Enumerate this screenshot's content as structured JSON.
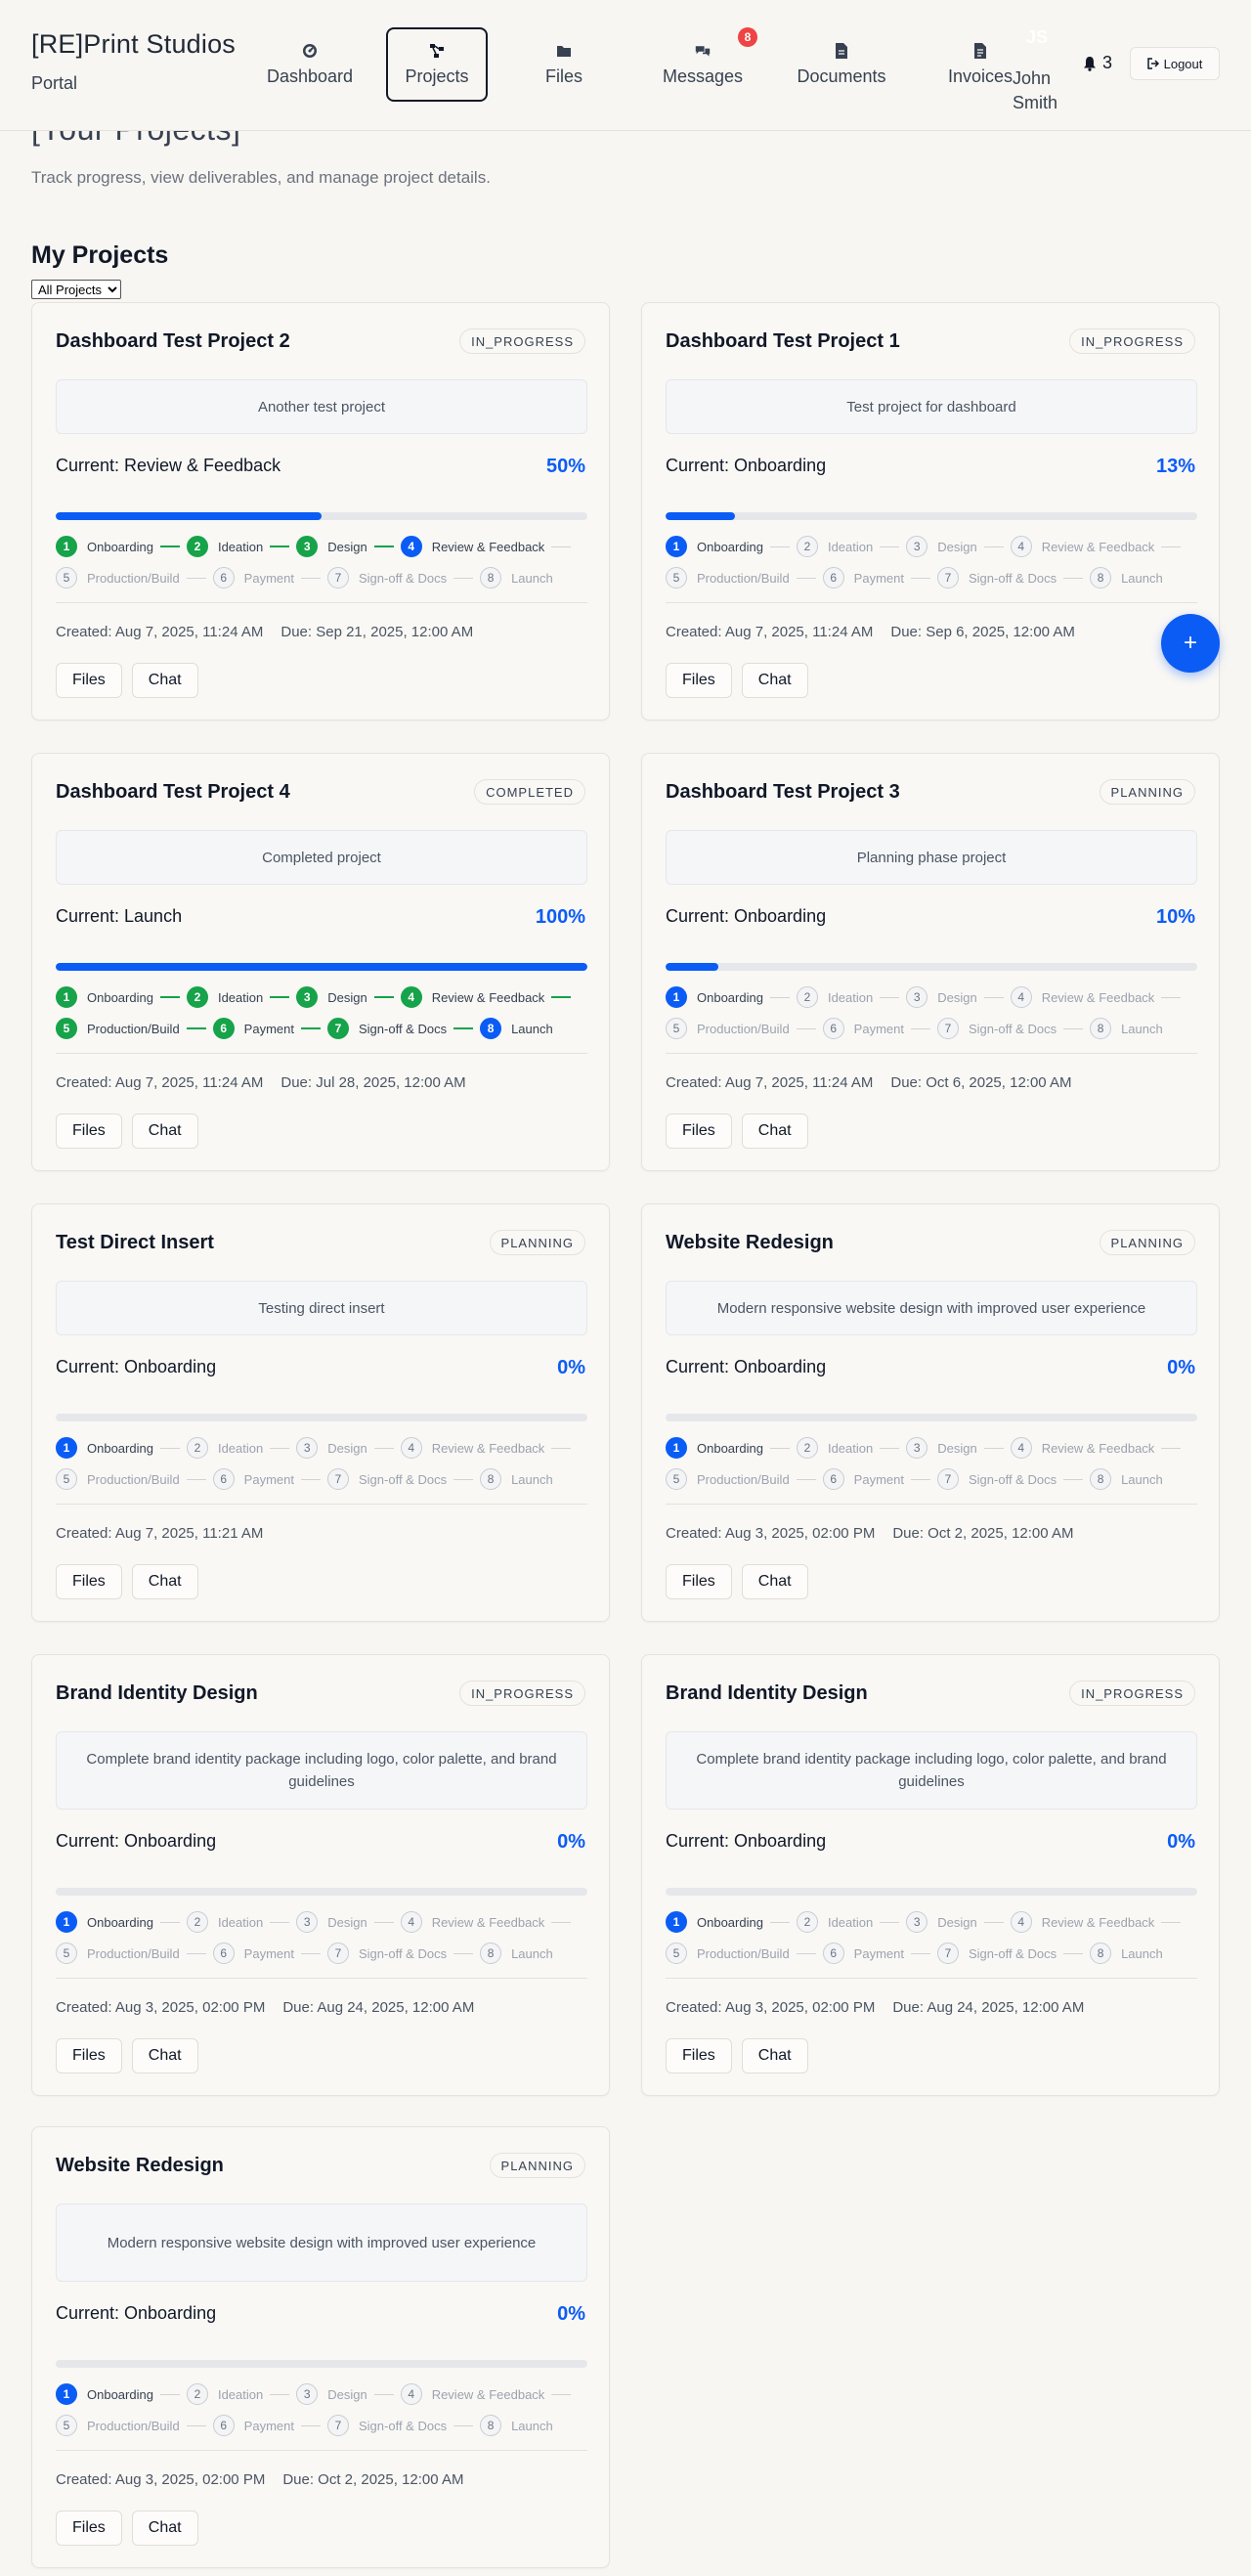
{
  "header": {
    "brand_title": "[RE]Print Studios",
    "brand_sub": "Portal",
    "nav": [
      {
        "label": "Dashboard",
        "icon": "dashboard-icon"
      },
      {
        "label": "Projects",
        "icon": "projects-icon",
        "active": true
      },
      {
        "label": "Files",
        "icon": "folder-icon"
      },
      {
        "label": "Messages",
        "icon": "messages-icon",
        "badge": "8"
      },
      {
        "label": "Documents",
        "icon": "document-icon"
      },
      {
        "label": "Invoices",
        "icon": "invoice-icon"
      }
    ],
    "user_initials": "JS",
    "user_name": "John Smith",
    "notification_count": "3",
    "logout_label": "Logout"
  },
  "intro": {
    "title": "[Your Projects]",
    "subtitle": "Track progress, view deliverables, and manage project details."
  },
  "projects_section": {
    "title": "My Projects",
    "filter_value": "All Projects"
  },
  "step_names": [
    "Onboarding",
    "Ideation",
    "Design",
    "Review & Feedback",
    "Production/Build",
    "Payment",
    "Sign-off & Docs",
    "Launch"
  ],
  "projects": [
    {
      "name": "Dashboard Test Project 2",
      "status": "IN_PROGRESS",
      "description": "Another test project",
      "current": "Current: Review & Feedback",
      "percent": "50%",
      "progress": 0.5,
      "current_step": 4,
      "completed_all": false,
      "created": "Created: Aug 7, 2025, 11:24 AM",
      "due": "Due: Sep 21, 2025, 12:00 AM"
    },
    {
      "name": "Dashboard Test Project 1",
      "status": "IN_PROGRESS",
      "description": "Test project for dashboard",
      "current": "Current: Onboarding",
      "percent": "13%",
      "progress": 0.13,
      "current_step": 1,
      "completed_all": false,
      "created": "Created: Aug 7, 2025, 11:24 AM",
      "due": "Due: Sep 6, 2025, 12:00 AM"
    },
    {
      "name": "Dashboard Test Project 4",
      "status": "COMPLETED",
      "description": "Completed project",
      "current": "Current: Launch",
      "percent": "100%",
      "progress": 1.0,
      "current_step": 8,
      "completed_all": true,
      "created": "Created: Aug 7, 2025, 11:24 AM",
      "due": "Due: Jul 28, 2025, 12:00 AM"
    },
    {
      "name": "Dashboard Test Project 3",
      "status": "PLANNING",
      "description": "Planning phase project",
      "current": "Current: Onboarding",
      "percent": "10%",
      "progress": 0.1,
      "current_step": 1,
      "completed_all": false,
      "created": "Created: Aug 7, 2025, 11:24 AM",
      "due": "Due: Oct 6, 2025, 12:00 AM"
    },
    {
      "name": "Test Direct Insert",
      "status": "PLANNING",
      "description": "Testing direct insert",
      "current": "Current: Onboarding",
      "percent": "0%",
      "progress": 0,
      "current_step": 1,
      "completed_all": false,
      "created": "Created: Aug 7, 2025, 11:21 AM",
      "due": ""
    },
    {
      "name": "Website Redesign",
      "status": "PLANNING",
      "description": "Modern responsive website design with improved user experience",
      "current": "Current: Onboarding",
      "percent": "0%",
      "progress": 0,
      "current_step": 1,
      "completed_all": false,
      "created": "Created: Aug 3, 2025, 02:00 PM",
      "due": "Due: Oct 2, 2025, 12:00 AM"
    },
    {
      "name": "Brand Identity Design",
      "status": "IN_PROGRESS",
      "description": "Complete brand identity package including logo, color palette, and brand guidelines",
      "current": "Current: Onboarding",
      "percent": "0%",
      "progress": 0,
      "current_step": 1,
      "completed_all": false,
      "created": "Created: Aug 3, 2025, 02:00 PM",
      "due": "Due: Aug 24, 2025, 12:00 AM"
    },
    {
      "name": "Brand Identity Design",
      "status": "IN_PROGRESS",
      "description": "Complete brand identity package including logo, color palette, and brand guidelines",
      "current": "Current: Onboarding",
      "percent": "0%",
      "progress": 0,
      "current_step": 1,
      "completed_all": false,
      "created": "Created: Aug 3, 2025, 02:00 PM",
      "due": "Due: Aug 24, 2025, 12:00 AM"
    },
    {
      "name": "Website Redesign",
      "status": "PLANNING",
      "description": "Modern responsive website design with improved user experience",
      "current": "Current: Onboarding",
      "percent": "0%",
      "progress": 0,
      "current_step": 1,
      "completed_all": false,
      "created": "Created: Aug 3, 2025, 02:00 PM",
      "due": "Due: Oct 2, 2025, 12:00 AM"
    }
  ],
  "card_actions": {
    "files_label": "Files",
    "chat_label": "Chat"
  },
  "fab_label": "+",
  "colors": {
    "accent": "#0b5cf5",
    "done": "#16a34a",
    "badge": "#ef4444"
  }
}
